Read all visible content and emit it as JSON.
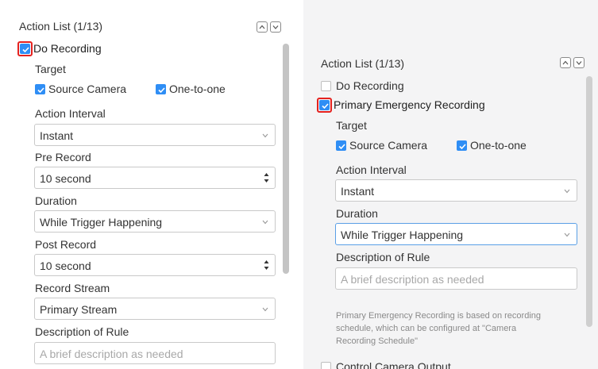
{
  "left": {
    "title": "Action List (1/13)",
    "do_recording": {
      "label": "Do Recording",
      "checked": true
    },
    "target_label": "Target",
    "targets": [
      {
        "label": "Source Camera",
        "checked": true
      },
      {
        "label": "One-to-one",
        "checked": true
      }
    ],
    "action_interval": {
      "label": "Action Interval",
      "value": "Instant"
    },
    "pre_record": {
      "label": "Pre Record",
      "value": "10 second"
    },
    "duration": {
      "label": "Duration",
      "value": "While Trigger Happening"
    },
    "post_record": {
      "label": "Post Record",
      "value": "10 second"
    },
    "record_stream": {
      "label": "Record Stream",
      "value": "Primary Stream"
    },
    "description": {
      "label": "Description of Rule",
      "placeholder": "A brief description as needed"
    }
  },
  "right": {
    "title": "Action List (1/13)",
    "do_recording": {
      "label": "Do Recording",
      "checked": false
    },
    "primary_emergency": {
      "label": "Primary Emergency Recording",
      "checked": true
    },
    "target_label": "Target",
    "targets": [
      {
        "label": "Source Camera",
        "checked": true
      },
      {
        "label": "One-to-one",
        "checked": true
      }
    ],
    "action_interval": {
      "label": "Action Interval",
      "value": "Instant"
    },
    "duration": {
      "label": "Duration",
      "value": "While Trigger Happening"
    },
    "description": {
      "label": "Description of Rule",
      "placeholder": "A brief description as needed"
    },
    "note_lines": [
      "Primary Emergency Recording is based on recording",
      "schedule, which can be configured at \"Camera",
      "Recording Schedule\""
    ],
    "control_camera_output": {
      "label": "Control Camera Output",
      "checked": false
    }
  },
  "colors": {
    "accent": "#2f8ef5",
    "highlight": "#e5221f",
    "focus_border": "#5a9fe6"
  },
  "icons": [
    "chevron-up-icon",
    "chevron-down-icon",
    "checkmark-icon",
    "spinner-arrows-icon"
  ]
}
